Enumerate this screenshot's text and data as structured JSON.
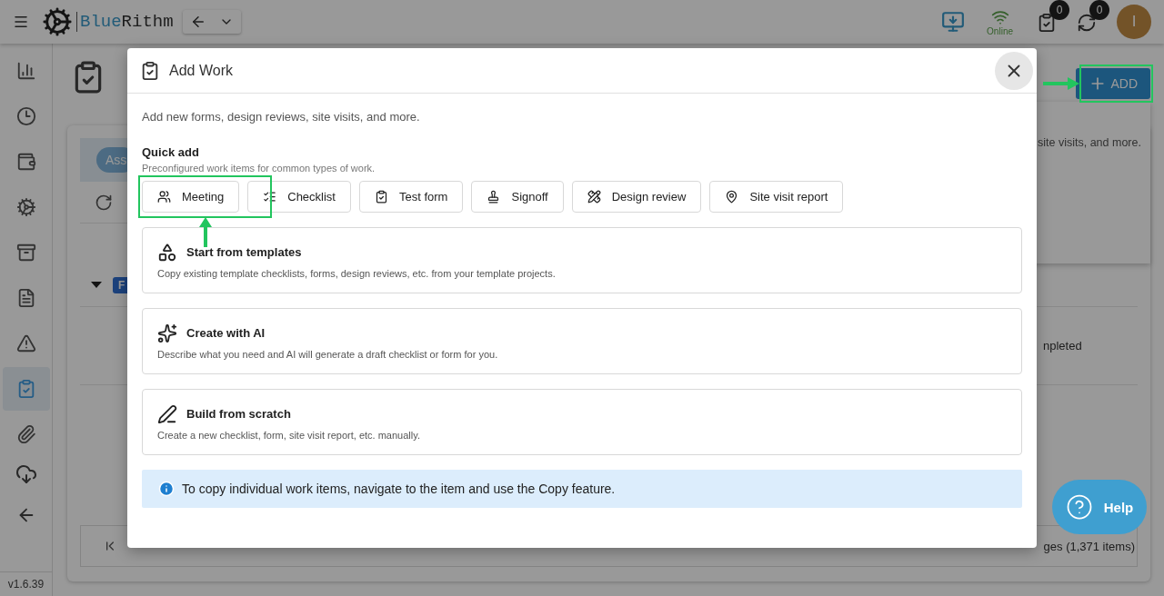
{
  "header": {
    "logo": {
      "part_1": "Blue",
      "part_2": "Rithm"
    },
    "connection": "Online",
    "tasks_badge": "0",
    "sync_badge": "0",
    "avatar": "I"
  },
  "sidebar": {
    "items": [
      {
        "selected": false
      },
      {
        "selected": false
      },
      {
        "selected": false
      },
      {
        "selected": false
      },
      {
        "selected": false
      },
      {
        "selected": false
      },
      {
        "selected": false
      },
      {
        "selected": true
      },
      {
        "selected": false
      }
    ],
    "version": "v1.6.39"
  },
  "page": {
    "add_button": "ADD",
    "tab_fragment": "Ass",
    "badge_fragment": "F",
    "popover_text": "site visits, and more.",
    "row_fragment": "npleted",
    "pagination": {
      "summary": "ges (1,371 items)"
    },
    "help_button": "Help"
  },
  "modal": {
    "title": "Add Work",
    "intro": "Add new forms, design reviews, site visits, and more.",
    "quick_add": {
      "heading": "Quick add",
      "hint": "Preconfigured work items for common types of work.",
      "items": [
        "Meeting",
        "Checklist",
        "Test form",
        "Signoff",
        "Design review",
        "Site visit report"
      ]
    },
    "options": [
      {
        "title": "Start from templates",
        "description": "Copy existing template checklists, forms, design reviews, etc. from your template projects."
      },
      {
        "title": "Create with AI",
        "description": "Describe what you need and AI will generate a draft checklist or form for you."
      },
      {
        "title": "Build from scratch",
        "description": "Create a new checklist, form, site visit report, etc. manually."
      }
    ],
    "info": "To copy individual work items, navigate to the item and use the Copy feature."
  }
}
